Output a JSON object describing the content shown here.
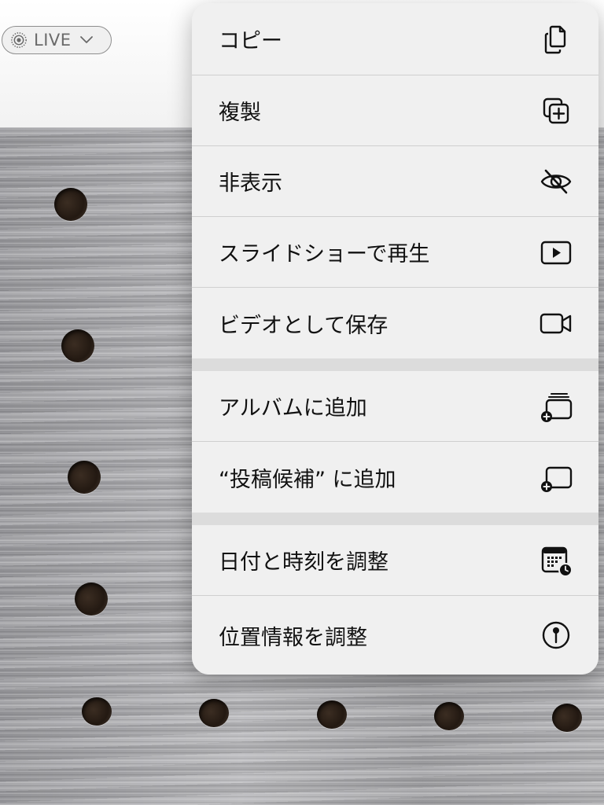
{
  "live_badge": {
    "label": "LIVE"
  },
  "menu": {
    "items": [
      {
        "label": "コピー",
        "icon": "copy-icon"
      },
      {
        "label": "複製",
        "icon": "duplicate-icon"
      },
      {
        "label": "非表示",
        "icon": "eye-slash-icon"
      },
      {
        "label": "スライドショーで再生",
        "icon": "play-rectangle-icon"
      },
      {
        "label": "ビデオとして保存",
        "icon": "video-icon"
      },
      {
        "label": "アルバムに追加",
        "icon": "add-to-album-icon"
      },
      {
        "label": "“投稿候補” に追加",
        "icon": "add-to-featured-icon"
      },
      {
        "label": "日付と時刻を調整",
        "icon": "calendar-clock-icon"
      },
      {
        "label": "位置情報を調整",
        "icon": "location-pin-icon"
      }
    ]
  }
}
